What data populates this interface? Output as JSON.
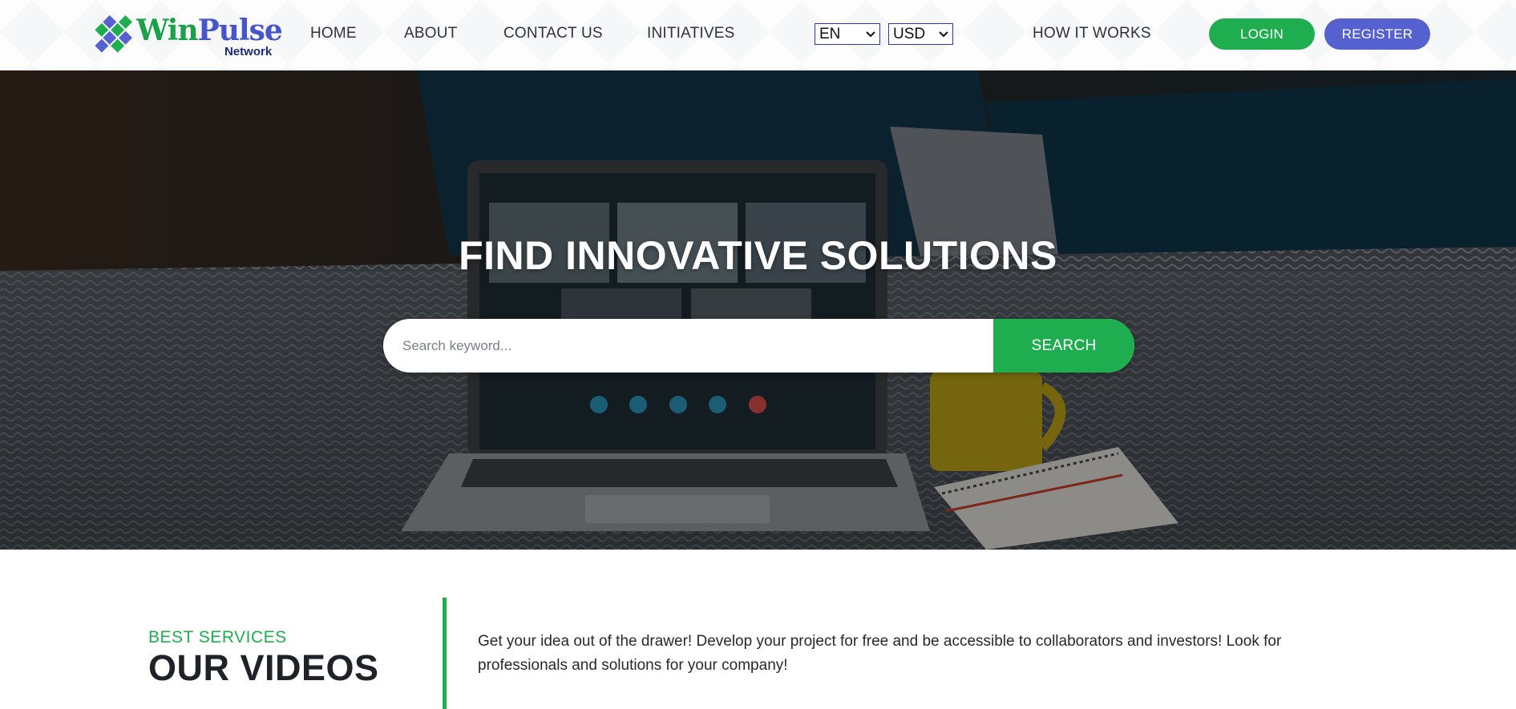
{
  "brand": {
    "name_part1": "Win",
    "name_part2": "Pulse",
    "subtitle": "Network",
    "colors": {
      "green": "#1fae4f",
      "blue": "#5661d0",
      "navy": "#1e2a78"
    }
  },
  "nav": {
    "items": [
      {
        "label": "HOME"
      },
      {
        "label": "ABOUT"
      },
      {
        "label": "CONTACT US"
      },
      {
        "label": "INITIATIVES"
      }
    ],
    "language": {
      "selected": "EN"
    },
    "currency": {
      "selected": "USD"
    },
    "how_it_works": "HOW IT WORKS",
    "login": "LOGIN",
    "register": "REGISTER"
  },
  "hero": {
    "title": "FIND INNOVATIVE SOLUTIONS",
    "search": {
      "placeholder": "Search keyword...",
      "value": "",
      "button": "SEARCH"
    }
  },
  "services": {
    "kicker": "BEST SERVICES",
    "title": "OUR VIDEOS",
    "description": "Get your idea out of the drawer! Develop your project for free and be accessible to collaborators and investors! Look for professionals and solutions for your company!"
  },
  "icons": [
    "logo-diamond-icon",
    "chevron-down-icon"
  ]
}
